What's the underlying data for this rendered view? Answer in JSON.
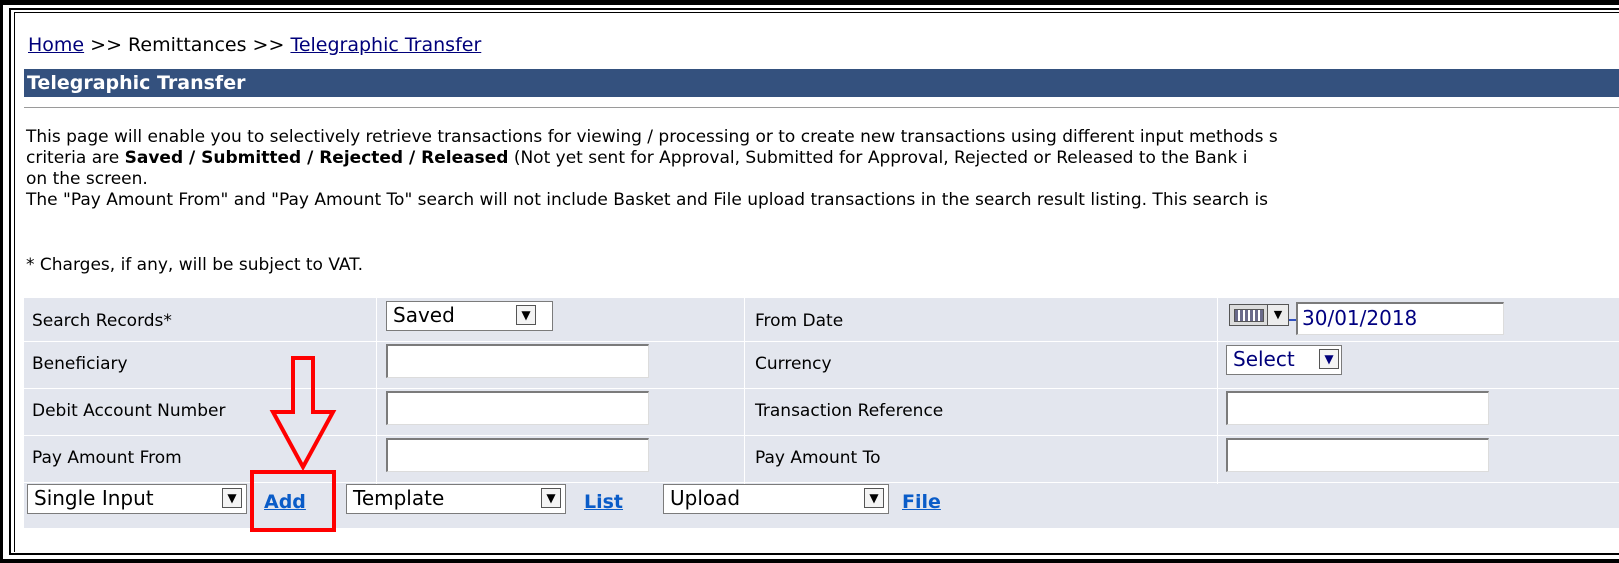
{
  "breadcrumb": {
    "home": "Home",
    "sep1": ">>",
    "remittances": "Remittances",
    "sep2": ">>",
    "current": "Telegraphic Transfer"
  },
  "page_title": "Telegraphic Transfer",
  "description": {
    "line1": "This page will enable you to selectively retrieve transactions for viewing / processing or to create new transactions using different input methods s",
    "line2_pre": "criteria are ",
    "line2_bold": "Saved / Submitted / Rejected / Released",
    "line2_post": " (Not yet sent for Approval, Submitted for Approval, Rejected or Released to the Bank i",
    "line3": "on the screen.",
    "line4": "The \"Pay Amount From\" and \"Pay Amount To\" search will not include Basket and File upload transactions in the search result listing. This search is",
    "note": "* Charges, if any, will be subject to VAT."
  },
  "form": {
    "search_records_label": "Search Records*",
    "search_records_value": "Saved",
    "beneficiary_label": "Beneficiary",
    "beneficiary_value": "",
    "debit_account_label": "Debit Account Number",
    "debit_account_value": "",
    "pay_amount_from_label": "Pay Amount From",
    "pay_amount_from_value": "",
    "from_date_label": "From Date",
    "from_date_value": "30/01/2018",
    "currency_label": "Currency",
    "currency_value": "Select",
    "transaction_reference_label": "Transaction Reference",
    "transaction_reference_value": "",
    "pay_amount_to_label": "Pay Amount To",
    "pay_amount_to_value": ""
  },
  "actions": {
    "input_method_value": "Single Input",
    "add_link": "Add",
    "template_value": "Template",
    "list_link": "List",
    "upload_value": "Upload",
    "file_link": "File"
  },
  "colors": {
    "title_bar": "#34517e",
    "form_background": "#e3e6ee",
    "link": "#00007a",
    "action_link": "#0a5cc8",
    "annotation": "#ff0000"
  }
}
